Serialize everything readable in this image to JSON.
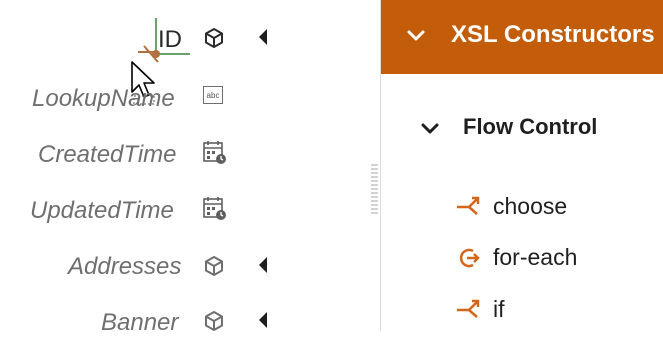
{
  "mapper": {
    "source_fields": [
      {
        "label": "ID",
        "icon": "object-icon",
        "expandable": true
      },
      {
        "label": "LookupName",
        "icon": "string-icon",
        "expandable": false
      },
      {
        "label": "CreatedTime",
        "icon": "datetime-icon",
        "expandable": false
      },
      {
        "label": "UpdatedTime",
        "icon": "datetime-icon",
        "expandable": false
      },
      {
        "label": "Addresses",
        "icon": "object-icon",
        "expandable": true
      },
      {
        "label": "Banner",
        "icon": "object-icon",
        "expandable": true
      }
    ],
    "string_icon_text": "abc"
  },
  "palette": {
    "title": "XSL Constructors",
    "header_color": "#c35d0a",
    "group": "Flow Control",
    "items": [
      {
        "label": "choose",
        "icon": "choose-icon"
      },
      {
        "label": "for-each",
        "icon": "for-each-icon"
      },
      {
        "label": "if",
        "icon": "if-icon"
      }
    ],
    "accent_color": "#d4661b"
  }
}
